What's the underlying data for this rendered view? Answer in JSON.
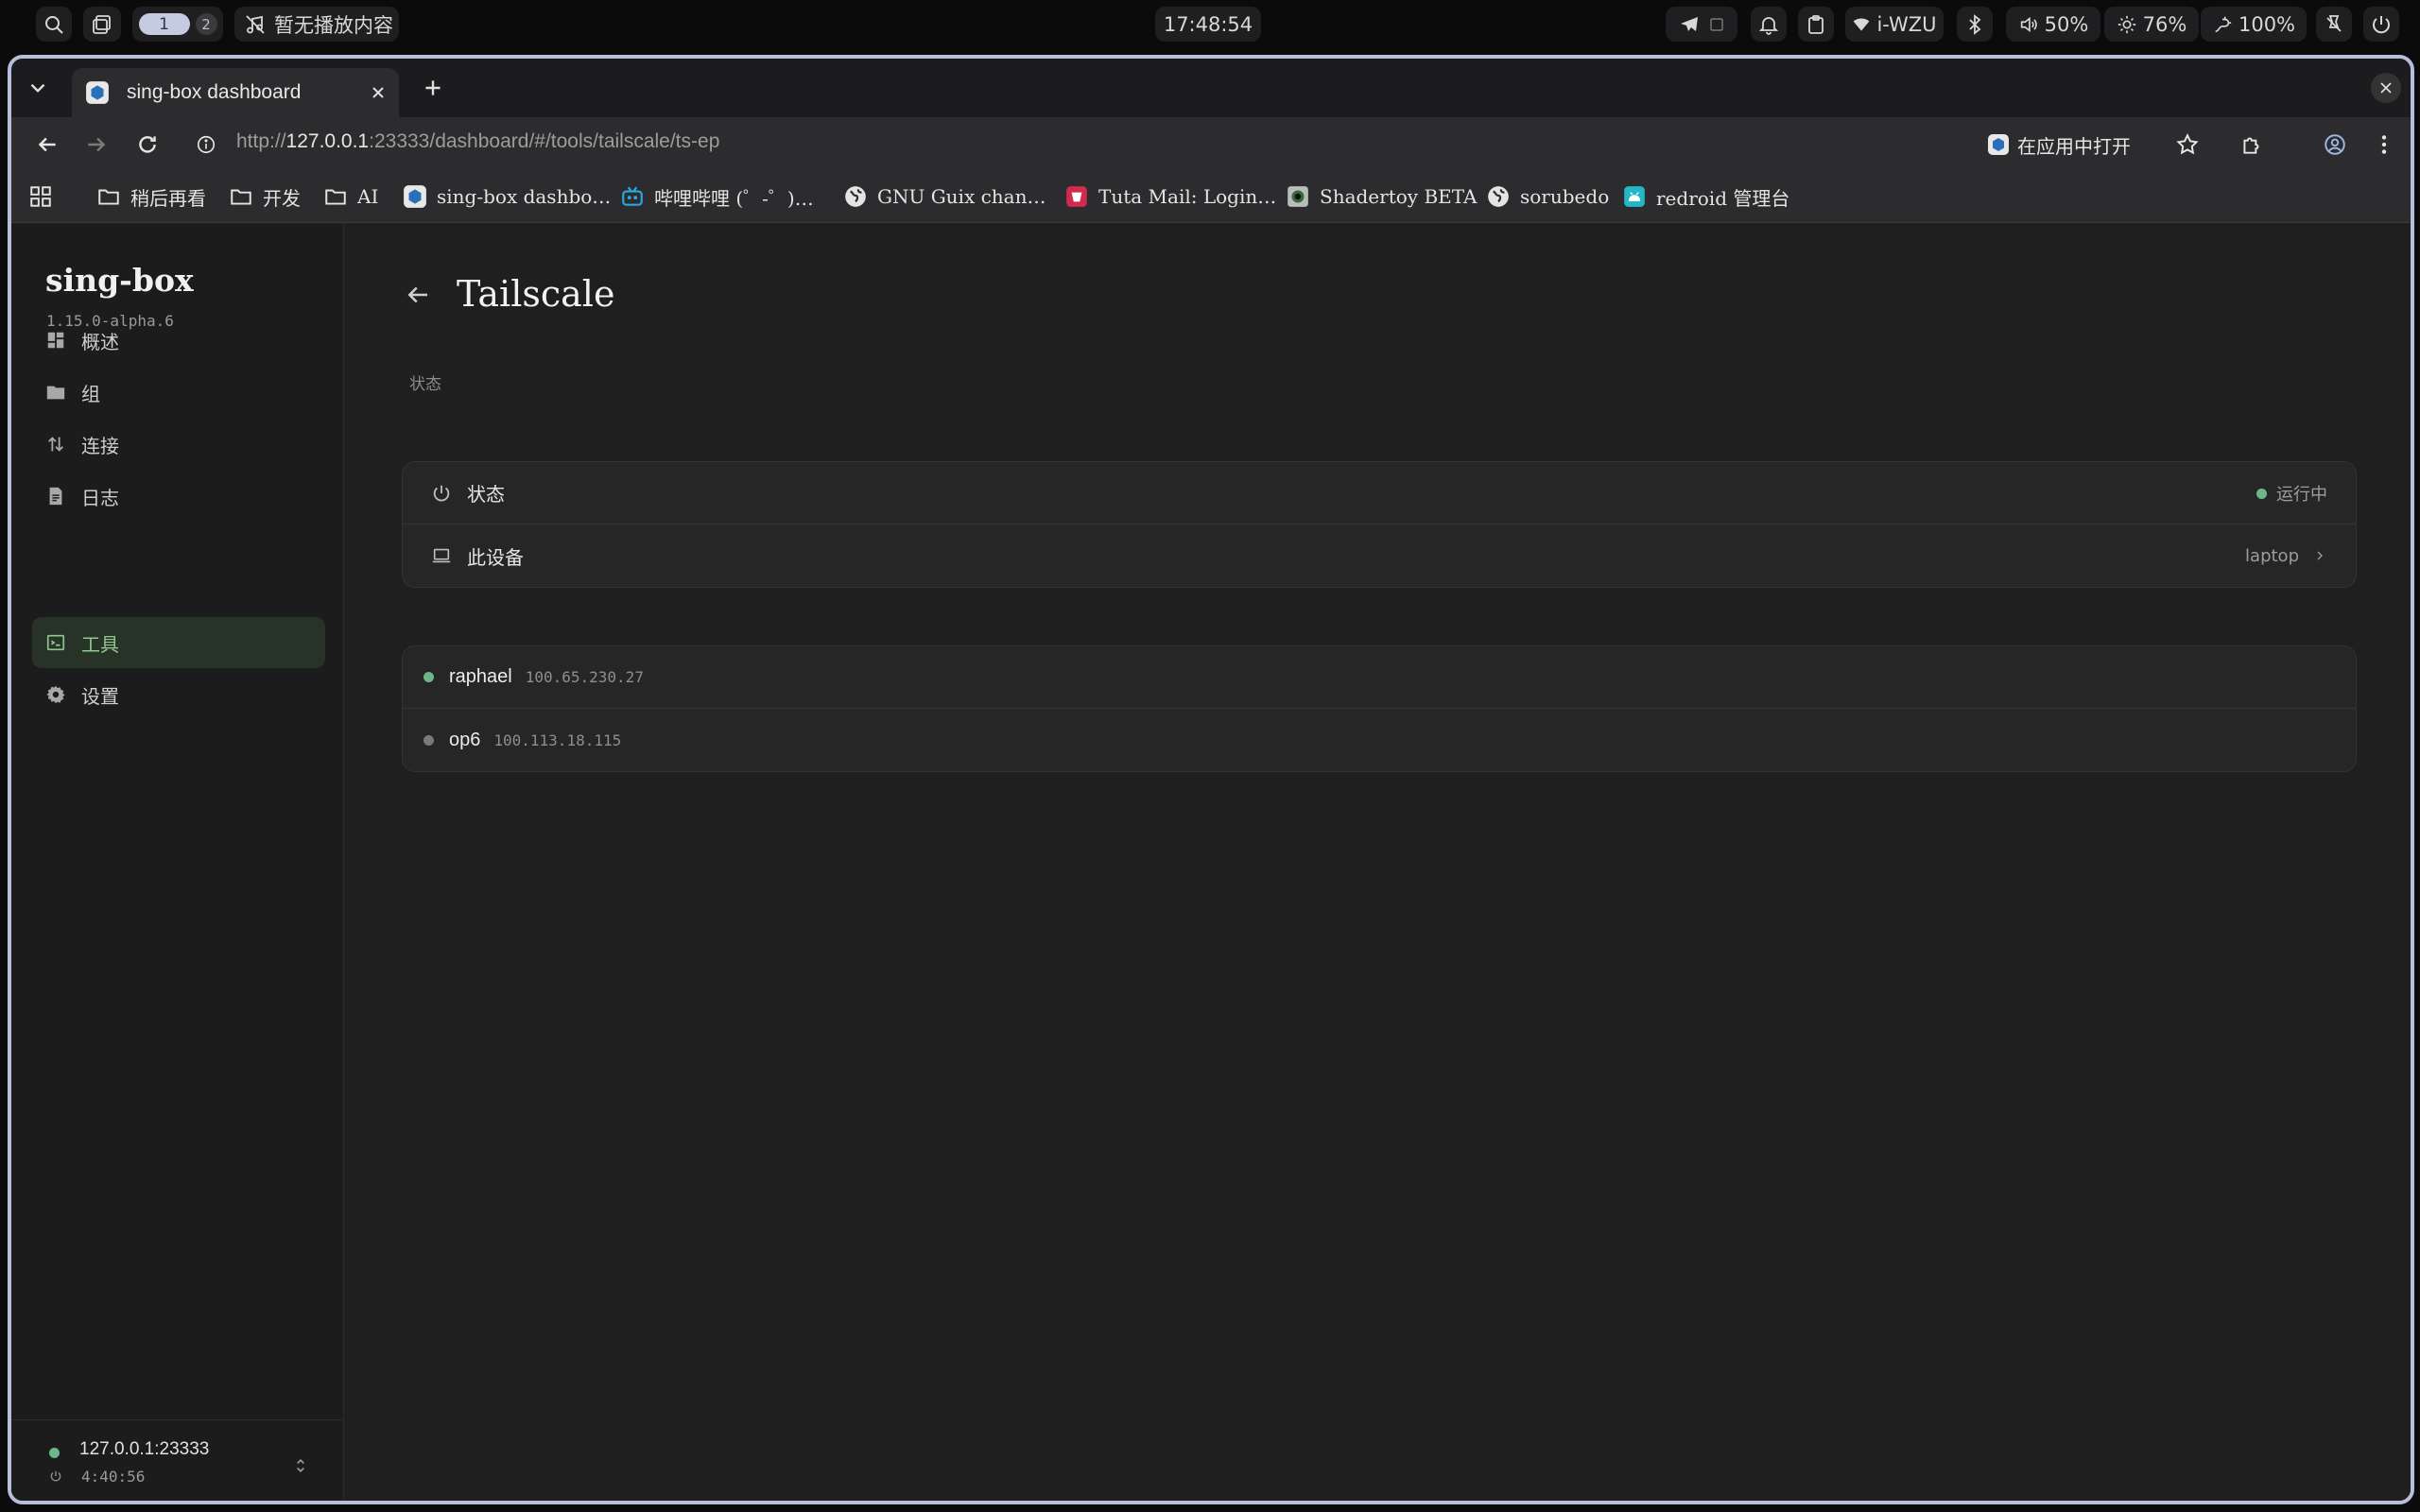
{
  "system_bar": {
    "workspace_active": "1",
    "workspace_other": "2",
    "media_status": "暂无播放内容",
    "clock": "17:48:54",
    "wifi": "i-WZU",
    "volume": "50%",
    "brightness": "76%",
    "battery": "100%"
  },
  "browser": {
    "tab_title": "sing-box dashboard",
    "url_scheme": "http://",
    "url_host": "127.0.0.1",
    "url_rest": ":23333/dashboard/#/tools/tailscale/ts-ep",
    "open_in_app": "在应用中打开",
    "bookmarks": [
      {
        "label": "稍后再看",
        "icon": "folder-icon"
      },
      {
        "label": "开发",
        "icon": "folder-icon"
      },
      {
        "label": "AI",
        "icon": "folder-icon"
      },
      {
        "label": "sing-box dashbo…",
        "icon": "singbox-icon"
      },
      {
        "label": "哔哩哔哩 (゜-゜)…",
        "icon": "bilibili-icon"
      },
      {
        "label": "GNU Guix chan…",
        "icon": "globe-icon"
      },
      {
        "label": "Tuta Mail: Login…",
        "icon": "tuta-icon"
      },
      {
        "label": "Shadertoy BETA",
        "icon": "shadertoy-icon"
      },
      {
        "label": "sorubedo",
        "icon": "globe-icon"
      },
      {
        "label": "redroid 管理台",
        "icon": "redroid-icon"
      }
    ]
  },
  "sidebar": {
    "brand": "sing-box",
    "version": "1.15.0-alpha.6",
    "items": [
      {
        "label": "概述",
        "icon": "dashboard-icon"
      },
      {
        "label": "组",
        "icon": "folder-icon"
      },
      {
        "label": "连接",
        "icon": "swap-icon"
      },
      {
        "label": "日志",
        "icon": "log-icon"
      },
      {
        "label": "工具",
        "icon": "terminal-icon",
        "active": true
      },
      {
        "label": "设置",
        "icon": "gear-icon"
      }
    ],
    "footer": {
      "address": "127.0.0.1:23333",
      "uptime": "4:40:56"
    }
  },
  "main": {
    "title": "Tailscale",
    "section_label": "状态",
    "status_card": {
      "status_label": "状态",
      "status_value": "运行中",
      "device_label": "此设备",
      "device_value": "laptop"
    },
    "peers": [
      {
        "name": "raphael",
        "ip": "100.65.230.27",
        "online": true
      },
      {
        "name": "op6",
        "ip": "100.113.18.115",
        "online": false
      }
    ]
  },
  "colors": {
    "accent_green": "#6fb58a",
    "active_nav_bg": "#273327",
    "offline_gray": "#7a7a7a",
    "window_border": "#b6bedc"
  }
}
